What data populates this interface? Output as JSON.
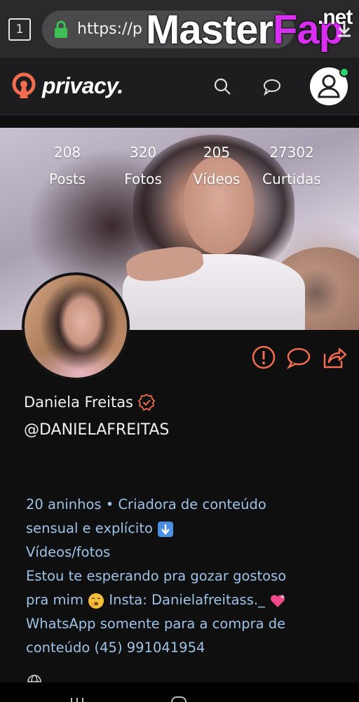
{
  "browser": {
    "tab_count": "1",
    "url": "https://p",
    "watermark_main": "Master",
    "watermark_accent": "Fap",
    "watermark_tld": ".net"
  },
  "header": {
    "brand_name": "privacy.",
    "icons": [
      "search-icon",
      "chat-icon",
      "user-avatar-icon"
    ],
    "online_color": "#2bd36a"
  },
  "stats": [
    {
      "value": "208",
      "label": "Posts"
    },
    {
      "value": "320",
      "label": "Fotos"
    },
    {
      "value": "205",
      "label": "Vídeos"
    },
    {
      "value": "27302",
      "label": "Curtidas"
    }
  ],
  "actions": [
    "report-icon",
    "message-icon",
    "share-icon"
  ],
  "profile": {
    "name": "Daniela Freitas",
    "handle": "@DANIELAFREITAS"
  },
  "bio": {
    "line1": "20 aninhos • Criadora de conteúdo",
    "line2": "sensual e explícito",
    "line3": "Vídeos/fotos",
    "line4": "Estou te esperando pra gozar gostoso",
    "line5a": "pra mim",
    "line5b": "Insta: Danielafreitass._",
    "line6": "WhatsApp somente para a compra de",
    "line7": "conteúdo (45) 991041954"
  },
  "colors": {
    "accent": "#f26d4f",
    "bio_text": "#9ec3e6",
    "background": "#0f0f10"
  }
}
